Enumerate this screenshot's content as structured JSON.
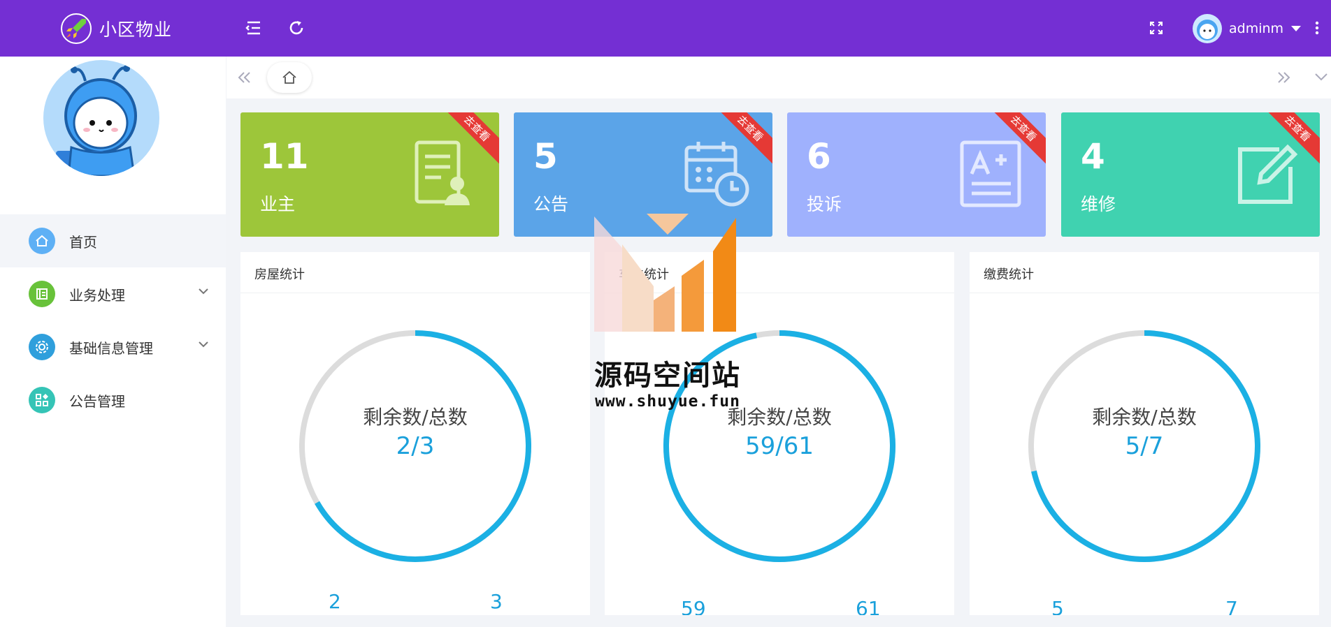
{
  "header": {
    "app_name": "小区物业",
    "username": "adminm",
    "icons": [
      "rocket-logo-icon",
      "collapse-menu-icon",
      "refresh-icon",
      "fullscreen-icon",
      "caret-down-icon",
      "more-vertical-icon"
    ]
  },
  "sidebar": {
    "items": [
      {
        "label": "首页",
        "icon": "home-icon",
        "color": "#5eb0f5",
        "active": true
      },
      {
        "label": "业务处理",
        "icon": "document-icon",
        "color": "#68c23a",
        "has_children": true
      },
      {
        "label": "基础信息管理",
        "icon": "gear-icon",
        "color": "#2f9fdc",
        "has_children": true
      },
      {
        "label": "公告管理",
        "icon": "grid-icon",
        "color": "#35c4b6"
      }
    ]
  },
  "tabs": {
    "home_icon": "home-icon"
  },
  "cards": [
    {
      "value": "11",
      "label": "业主",
      "ribbon": "去查看",
      "color": "#9dc63a",
      "icon": "owner-document-icon"
    },
    {
      "value": "5",
      "label": "公告",
      "ribbon": "去查看",
      "color": "#5ba4e8",
      "icon": "calendar-clock-icon"
    },
    {
      "value": "6",
      "label": "投诉",
      "ribbon": "去查看",
      "color": "#9fb1fd",
      "icon": "grade-document-icon"
    },
    {
      "value": "4",
      "label": "维修",
      "ribbon": "去查看",
      "color": "#40d2b0",
      "icon": "edit-icon"
    }
  ],
  "panels": [
    {
      "title": "房屋统计",
      "ring_label": "剩余数/总数",
      "ring_value": "2/3",
      "remaining": 2,
      "total": 3,
      "legend_left": "2",
      "legend_right": "3"
    },
    {
      "title": "车位统计",
      "ring_label": "剩余数/总数",
      "ring_value": "59/61",
      "remaining": 59,
      "total": 61,
      "legend_left": "59",
      "legend_right": "61"
    },
    {
      "title": "缴费统计",
      "ring_label": "剩余数/总数",
      "ring_value": "5/7",
      "remaining": 5,
      "total": 7,
      "legend_left": "5",
      "legend_right": "7"
    }
  ],
  "watermark": {
    "title": "源码空间站",
    "url": "www.shuyue.fun"
  },
  "colors": {
    "header_bg": "#742fd3",
    "ring_fill": "#1bb0e4",
    "ring_track": "#dcdcdc"
  }
}
